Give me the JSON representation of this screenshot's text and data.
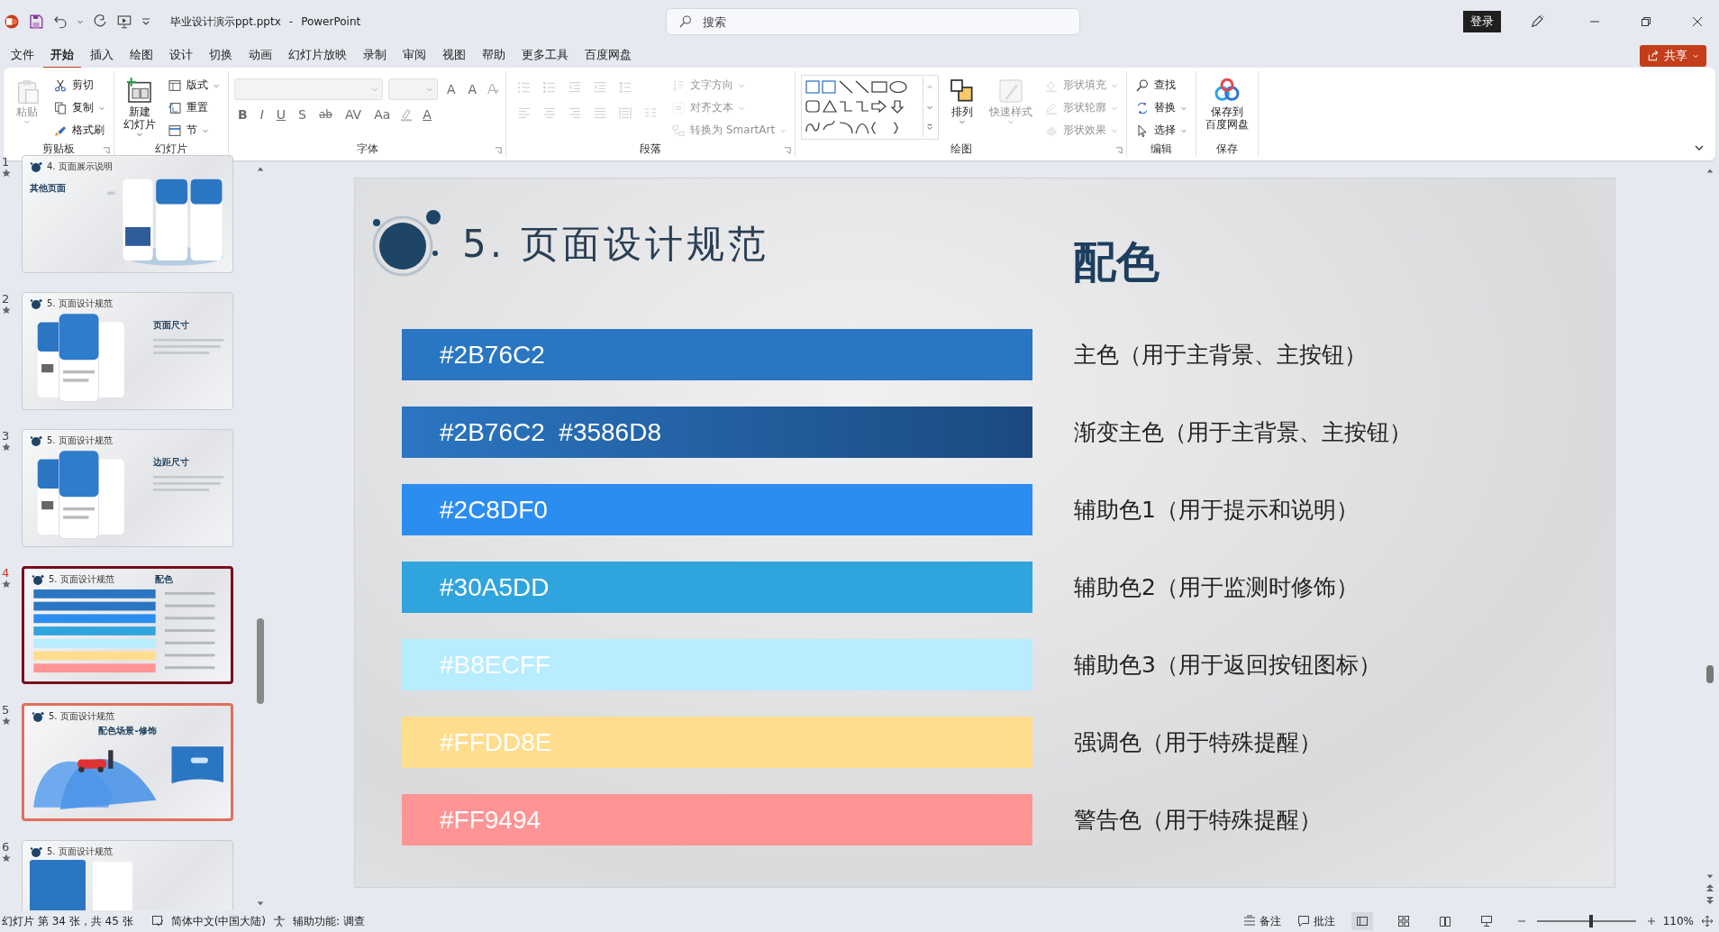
{
  "title_bar": {
    "file_name": "毕业设计演示ppt.pptx",
    "separator": "-",
    "app_name": "PowerPoint",
    "search": {
      "placeholder": "搜索"
    },
    "login_button": "登录"
  },
  "menu_tabs": [
    {
      "label": "文件",
      "selected": false
    },
    {
      "label": "开始",
      "selected": true
    },
    {
      "label": "插入",
      "selected": false
    },
    {
      "label": "绘图",
      "selected": false
    },
    {
      "label": "设计",
      "selected": false
    },
    {
      "label": "切换",
      "selected": false
    },
    {
      "label": "动画",
      "selected": false
    },
    {
      "label": "幻灯片放映",
      "selected": false
    },
    {
      "label": "录制",
      "selected": false
    },
    {
      "label": "审阅",
      "selected": false
    },
    {
      "label": "视图",
      "selected": false
    },
    {
      "label": "帮助",
      "selected": false
    },
    {
      "label": "更多工具",
      "selected": false
    },
    {
      "label": "百度网盘",
      "selected": false
    }
  ],
  "share_button": "共享",
  "ribbon": {
    "groups": [
      {
        "label": "剪贴板",
        "launcher": true,
        "items": [
          {
            "kind": "big",
            "lines": [
              "粘贴"
            ],
            "disabled": true,
            "dropdown": true
          },
          {
            "kind": "small",
            "label": "剪切",
            "disabled": false,
            "dropdown": false
          },
          {
            "kind": "small",
            "label": "复制",
            "disabled": false,
            "dropdown": true
          },
          {
            "kind": "small",
            "label": "格式刷",
            "disabled": false,
            "dropdown": false
          }
        ]
      },
      {
        "label": "幻灯片",
        "launcher": false,
        "items": [
          {
            "kind": "big",
            "lines": [
              "新建",
              "幻灯片"
            ],
            "disabled": false,
            "dropdown": true
          },
          {
            "kind": "small",
            "label": "版式",
            "disabled": false,
            "dropdown": true
          },
          {
            "kind": "small",
            "label": "重置",
            "disabled": false,
            "dropdown": false
          },
          {
            "kind": "small",
            "label": "节",
            "disabled": false,
            "dropdown": true
          }
        ]
      },
      {
        "label": "字体",
        "launcher": true,
        "items": [
          {
            "kind": "font",
            "disabled": true,
            "size_buttons": [
              "A",
              "A"
            ],
            "style_buttons": [
              "B",
              "I",
              "U",
              "S",
              "ab",
              "AV",
              "Aa"
            ],
            "color_button": "A"
          }
        ]
      },
      {
        "label": "段落",
        "launcher": true,
        "items": [
          {
            "kind": "paragraph",
            "disabled": true
          },
          {
            "kind": "small",
            "label": "文字方向",
            "disabled": true,
            "dropdown": true
          },
          {
            "kind": "small",
            "label": "对齐文本",
            "disabled": true,
            "dropdown": true
          },
          {
            "kind": "small",
            "label": "转换为 SmartArt",
            "disabled": true,
            "dropdown": true
          }
        ]
      },
      {
        "label": "绘图",
        "launcher": true,
        "items": [
          {
            "kind": "shapes",
            "disabled": false
          },
          {
            "kind": "big",
            "lines": [
              "排列"
            ],
            "disabled": false,
            "dropdown": true
          },
          {
            "kind": "big",
            "lines": [
              "快速样式"
            ],
            "disabled": true,
            "dropdown": true
          },
          {
            "kind": "small",
            "label": "形状填充",
            "disabled": true,
            "dropdown": true
          },
          {
            "kind": "small",
            "label": "形状轮廓",
            "disabled": true,
            "dropdown": true
          },
          {
            "kind": "small",
            "label": "形状效果",
            "disabled": true,
            "dropdown": true
          }
        ]
      },
      {
        "label": "编辑",
        "launcher": false,
        "items": [
          {
            "kind": "small",
            "label": "查找",
            "disabled": false,
            "dropdown": false
          },
          {
            "kind": "small",
            "label": "替换",
            "disabled": false,
            "dropdown": true
          },
          {
            "kind": "small",
            "label": "选择",
            "disabled": false,
            "dropdown": true
          }
        ]
      },
      {
        "label": "保存",
        "launcher": false,
        "items": [
          {
            "kind": "big",
            "lines": [
              "保存到",
              "百度网盘"
            ],
            "disabled": false,
            "dropdown": false
          }
        ]
      }
    ]
  },
  "thumbnails": [
    {
      "number": "1",
      "starred": true,
      "title": "4. 页面展示说明",
      "heading": "其他页面",
      "kind": "phones-right",
      "selected": false,
      "hover": false
    },
    {
      "number": "2",
      "starred": true,
      "title": "5. 页面设计规范",
      "heading": "页面尺寸",
      "kind": "phones-left",
      "selected": false,
      "hover": false
    },
    {
      "number": "3",
      "starred": true,
      "title": "5. 页面设计规范",
      "heading": "边距尺寸",
      "kind": "phones-left",
      "selected": false,
      "hover": false
    },
    {
      "number": "4",
      "starred": true,
      "title": "5. 页面设计规范",
      "heading": "配色",
      "kind": "palette",
      "selected": true,
      "hover": false
    },
    {
      "number": "5",
      "starred": true,
      "title": "5. 页面设计规范",
      "heading": "配色场景-修饰",
      "kind": "scene",
      "selected": false,
      "hover": true
    },
    {
      "number": "6",
      "starred": true,
      "title": "5. 页面设计规范",
      "kind": "panels",
      "selected": false,
      "hover": false
    }
  ],
  "slide": {
    "title": "5. 页面设计规范",
    "heading": "配色",
    "swatches": [
      {
        "label": "#2B76C2",
        "color": "#2b76c2",
        "description": "主色（用于主背景、主按钮）"
      },
      {
        "label": "#2B76C2  #3586D8",
        "color": "#2b76c2",
        "kind": "gradient",
        "description": "渐变主色（用于主背景、主按钮）"
      },
      {
        "label": "#2C8DF0",
        "color": "#2c8df0",
        "description": "辅助色1（用于提示和说明）"
      },
      {
        "label": "#30A5DD",
        "color": "#30a5dd",
        "description": "辅助色2（用于监测时修饰）"
      },
      {
        "label": "#B8ECFF",
        "color": "#b8ecff",
        "description": "辅助色3（用于返回按钮图标）"
      },
      {
        "label": "#FFDD8E",
        "color": "#ffdd8e",
        "description": "强调色（用于特殊提醒）"
      },
      {
        "label": "#FF9494",
        "color": "#ff9494",
        "description": "警告色（用于特殊提醒）"
      }
    ]
  },
  "status_bar": {
    "slide_info": "幻灯片 第 34 张，共 45 张",
    "language": "简体中文(中国大陆)",
    "accessibility": "辅助功能: 调查",
    "notes": "备注",
    "comments": "批注",
    "views": [
      {
        "selected": true
      },
      {
        "selected": false
      },
      {
        "selected": false
      },
      {
        "selected": false
      }
    ],
    "zoom": {
      "level": 0.55,
      "reading": "110%"
    }
  }
}
